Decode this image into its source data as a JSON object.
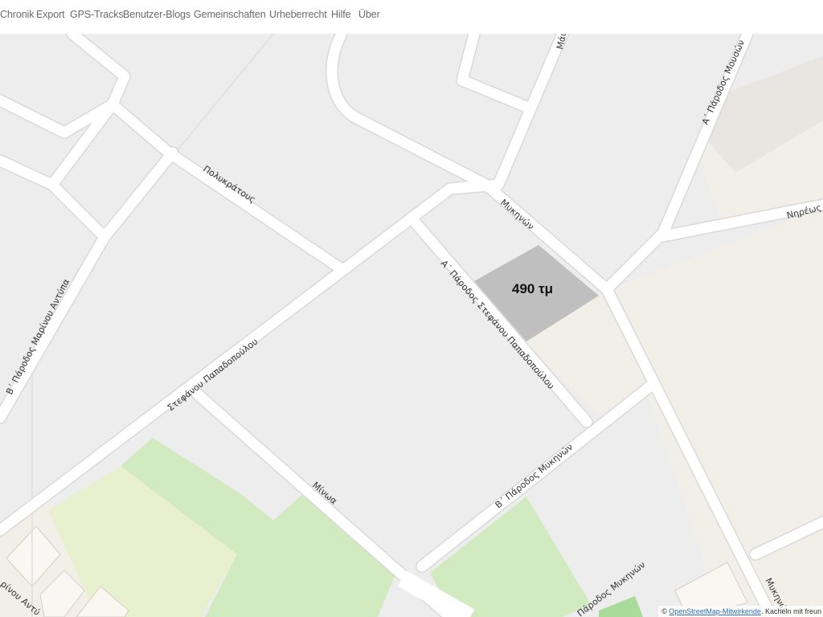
{
  "nav": {
    "items": [
      {
        "id": "chronik",
        "label": "Chronik"
      },
      {
        "id": "export",
        "label": "Export"
      },
      {
        "id": "gps",
        "label": "GPS-Tracks"
      },
      {
        "id": "blogs",
        "label": "Benutzer-Blogs"
      },
      {
        "id": "gemeinschaften",
        "label": "Gemeinschaften"
      },
      {
        "id": "urheberrecht",
        "label": "Urheberrecht"
      },
      {
        "id": "hilfe",
        "label": "Hilfe"
      },
      {
        "id": "uber",
        "label": "Über"
      }
    ]
  },
  "map": {
    "parcel_label": "490 τμ",
    "streets": {
      "polykratous": "Πολυκράτους",
      "stefanou": "Στεφάνου Παπαδοπούλου",
      "a_parodos_stefanou": "Α΄ Πάροδος Στεφάνου Παπαδοπούλου",
      "mykinon": "Μυκηνών",
      "mykinon_bottom": "Μυκηνώ",
      "minoa": "Μίνωα",
      "b_parodos_mykinon": "Β΄ Πάροδος Μυκηνών",
      "parodos_mykinon_bottom": "Πάροδος Μυκηνών",
      "b_parodos_marinou": "Β΄ Πάροδος Μαρίνου Αντύπα",
      "marinou_bottom": "ρίνου Αντύ",
      "a_parodos_mouson": "Α΄ Πάροδος Μουσών",
      "nireos": "Νηρέως",
      "top_cut": "Μάι"
    },
    "colors": {
      "background": "#ededed",
      "road": "#ffffff",
      "parcel": "#bfbfbf",
      "residential": "#f2efe9",
      "park": "#d1eac0",
      "grass_pale": "#e9f0cf",
      "building": "#faf6f1"
    }
  },
  "attribution": {
    "prefix": "©",
    "link": "OpenStreetMap-Mitwirkende",
    "suffix": ". Kacheln mit freun"
  }
}
